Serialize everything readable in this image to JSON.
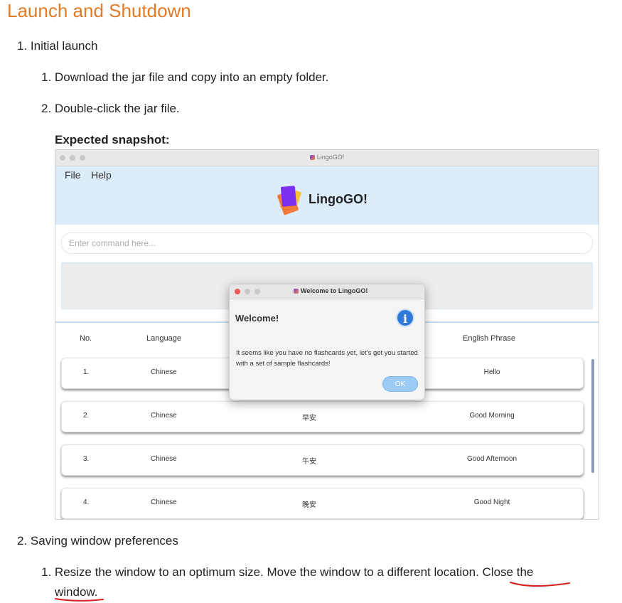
{
  "doc": {
    "heading": "Launch and Shutdown",
    "items": [
      {
        "number": "1.",
        "label": "Initial launch"
      },
      {
        "number": "2.",
        "label": "Saving window preferences"
      }
    ],
    "launch_steps": [
      {
        "number": "1.",
        "text": "Download the jar file and copy into an empty folder."
      },
      {
        "number": "2.",
        "text": "Double-click the jar file."
      }
    ],
    "expected_label": "Expected snapshot:",
    "pref_step": {
      "number": "1.",
      "text_part1": "Resize the window to an optimum size. Move the window to a different location. ",
      "text_link_a": "Close the",
      "text_link_b": "window."
    }
  },
  "app": {
    "window_title": "LingoGO!",
    "menu": [
      "File",
      "Help"
    ],
    "logo_text": "LingoGO!",
    "command_placeholder": "Enter command here...",
    "columns": [
      "No.",
      "Language",
      "English Phrase"
    ],
    "rows": [
      {
        "no": "1.",
        "language": "Chinese",
        "foreign": "",
        "english": "Hello"
      },
      {
        "no": "2.",
        "language": "Chinese",
        "foreign": "早安",
        "english": "Good Morning"
      },
      {
        "no": "3.",
        "language": "Chinese",
        "foreign": "午安",
        "english": "Good Afternoon"
      },
      {
        "no": "4.",
        "language": "Chinese",
        "foreign": "晚安",
        "english": "Good Night"
      }
    ]
  },
  "dialog": {
    "title": "Welcome to LingoGO!",
    "heading": "Welcome!",
    "message": "It seems like you have no flashcards yet, let's get you started with a set of sample flashcards!",
    "ok_label": "OK",
    "info_icon_glyph": "i"
  },
  "colors": {
    "heading": "#e07b28",
    "annotation": "#d62020",
    "ok_button": "#9ccbf5"
  }
}
